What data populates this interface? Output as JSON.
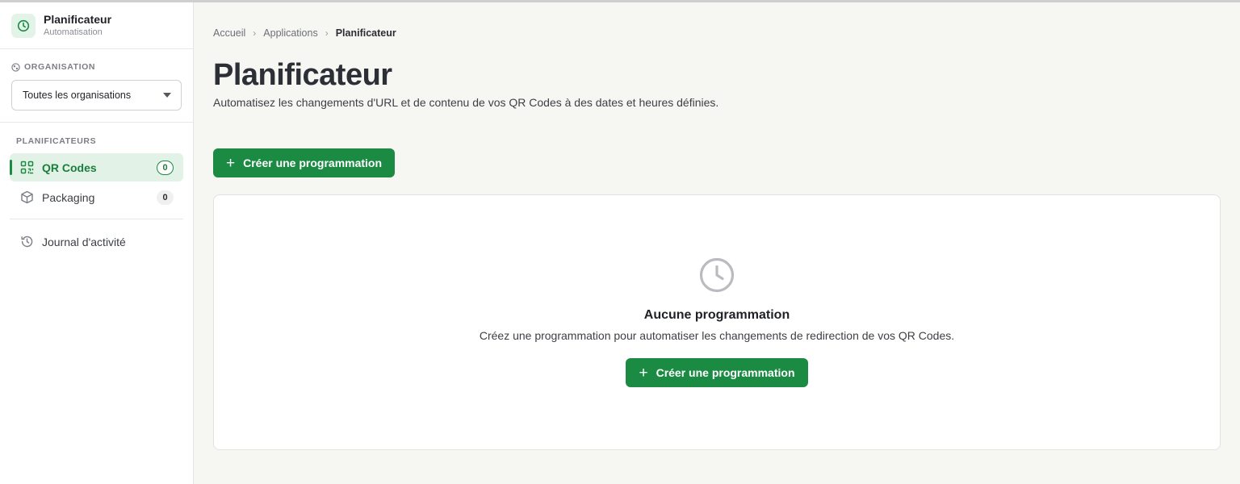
{
  "brand": {
    "title": "Planificateur",
    "subtitle": "Automatisation"
  },
  "organisation": {
    "section_label": "ORGANISATION",
    "selected": "Toutes les organisations"
  },
  "nav": {
    "section_label": "PLANIFICATEURS",
    "items": [
      {
        "label": "QR Codes",
        "count": "0",
        "active": true,
        "icon": "qr-code-icon"
      },
      {
        "label": "Packaging",
        "count": "0",
        "active": false,
        "icon": "box-icon"
      }
    ],
    "journal": {
      "label": "Journal d'activité",
      "icon": "history-icon"
    }
  },
  "breadcrumb": [
    "Accueil",
    "Applications",
    "Planificateur"
  ],
  "page": {
    "title": "Planificateur",
    "subtitle": "Automatisez les changements d'URL et de contenu de vos QR Codes à des dates et heures définies.",
    "create_label": "Créer une programmation"
  },
  "empty_state": {
    "icon": "clock-icon",
    "title": "Aucune programmation",
    "text": "Créez une programmation pour automatiser les changements de redirection de vos QR Codes.",
    "button_label": "Créer une programmation"
  },
  "colors": {
    "accent": "#1b8a43",
    "accent_soft": "#e3f2e7",
    "background": "#f6f6f3"
  }
}
